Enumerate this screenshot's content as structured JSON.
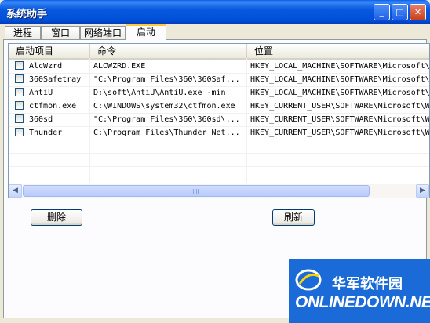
{
  "window": {
    "title": "系统助手",
    "min_glyph": "_",
    "max_glyph": "□",
    "close_glyph": "✕"
  },
  "tabs": [
    {
      "label": "进程",
      "active": false
    },
    {
      "label": "窗口",
      "active": false
    },
    {
      "label": "网络端口",
      "active": false
    },
    {
      "label": "启动",
      "active": true
    }
  ],
  "list": {
    "columns": [
      "启动项目",
      "命令",
      "位置"
    ],
    "rows": [
      {
        "name": "AlcWzrd",
        "command": "ALCWZRD.EXE",
        "location": "HKEY_LOCAL_MACHINE\\SOFTWARE\\Microsoft\\W"
      },
      {
        "name": "360Safetray",
        "command": "\"C:\\Program Files\\360\\360Saf...",
        "location": "HKEY_LOCAL_MACHINE\\SOFTWARE\\Microsoft\\W"
      },
      {
        "name": "AntiU",
        "command": "D:\\soft\\AntiU\\AntiU.exe -min",
        "location": "HKEY_LOCAL_MACHINE\\SOFTWARE\\Microsoft\\W"
      },
      {
        "name": "ctfmon.exe",
        "command": "C:\\WINDOWS\\system32\\ctfmon.exe",
        "location": "HKEY_CURRENT_USER\\SOFTWARE\\Microsoft\\Wi"
      },
      {
        "name": "360sd",
        "command": "\"C:\\Program Files\\360\\360sd\\...",
        "location": "HKEY_CURRENT_USER\\SOFTWARE\\Microsoft\\Wi"
      },
      {
        "name": "Thunder",
        "command": "C:\\Program Files\\Thunder Net...",
        "location": "HKEY_CURRENT_USER\\SOFTWARE\\Microsoft\\Wi"
      }
    ],
    "scroll_left_glyph": "◀",
    "scroll_right_glyph": "▶"
  },
  "buttons": {
    "delete": "删除",
    "refresh": "刷新"
  },
  "watermark": {
    "cn": "华军软件园",
    "en": "ONLINEDOWN.NET"
  },
  "colors": {
    "titlebar": "#0150d8",
    "face": "#ece9d8",
    "tab_highlight": "#ffc83c",
    "watermark_bg": "#1a6ad8"
  }
}
